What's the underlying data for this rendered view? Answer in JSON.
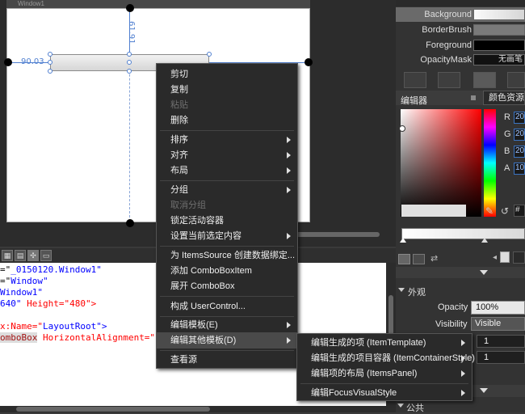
{
  "window": {
    "title": "Window1"
  },
  "design": {
    "height_label": "61.91",
    "left_label": "90.03"
  },
  "xaml_lines": [
    {
      "pre": "=\"",
      "val": "_0150120.Window1\"",
      "post": ""
    },
    {
      "pre": "=\"",
      "val": "Window\"",
      "post": ""
    },
    {
      "pre": "",
      "val": "Window1\"",
      "post": ""
    },
    {
      "pre": "",
      "val": "640\"",
      "post": " Height=\"480\">"
    },
    {
      "pre": "",
      "val": "",
      "post": ""
    },
    {
      "pre": "x:Name=\"",
      "val": "LayoutRoot\">",
      "post": ""
    },
    {
      "pre": "omboBox",
      "val": "",
      "post": " HorizontalAlignment=\"Lef"
    }
  ],
  "properties": {
    "brushes": [
      {
        "label": "Background",
        "color": "#e8e8e8"
      },
      {
        "label": "BorderBrush",
        "color": "#808080"
      },
      {
        "label": "Foreground",
        "color": "#000000"
      },
      {
        "label": "OpacityMask",
        "value": "无画笔"
      }
    ],
    "editor_label": "编辑器",
    "color_resources": "颜色资源",
    "rgba": [
      {
        "k": "R",
        "v": "20"
      },
      {
        "k": "G",
        "v": "20"
      },
      {
        "k": "B",
        "v": "20"
      },
      {
        "k": "A",
        "v": "10"
      }
    ],
    "hex_prefix": "#",
    "appearance_header": "外观",
    "opacity_label": "Opacity",
    "opacity_value": "100%",
    "visibility_label": "Visibility",
    "visibility_value": "Visible",
    "stepper1": "1",
    "stepper2": "1",
    "public_header": "公共"
  },
  "context_menu": {
    "items": [
      {
        "label": "剪切",
        "enabled": true,
        "submenu": false
      },
      {
        "label": "复制",
        "enabled": true,
        "submenu": false
      },
      {
        "label": "粘贴",
        "enabled": false,
        "submenu": false
      },
      {
        "label": "删除",
        "enabled": true,
        "submenu": false
      },
      {
        "label": "排序",
        "enabled": true,
        "submenu": true
      },
      {
        "label": "对齐",
        "enabled": true,
        "submenu": true
      },
      {
        "label": "布局",
        "enabled": true,
        "submenu": true
      },
      {
        "label": "分组",
        "enabled": true,
        "submenu": true
      },
      {
        "label": "取消分组",
        "enabled": false,
        "submenu": false
      },
      {
        "label": "锁定活动容器",
        "enabled": true,
        "submenu": false
      },
      {
        "label": "设置当前选定内容",
        "enabled": true,
        "submenu": true
      },
      {
        "label": "为 ItemsSource 创建数据绑定...",
        "enabled": true,
        "submenu": false
      },
      {
        "label": "添加 ComboBoxItem",
        "enabled": true,
        "submenu": false
      },
      {
        "label": "展开 ComboBox",
        "enabled": true,
        "submenu": false
      },
      {
        "label": "构成 UserControl...",
        "enabled": true,
        "submenu": false
      },
      {
        "label": "编辑模板(E)",
        "enabled": true,
        "submenu": true
      },
      {
        "label": "编辑其他模板(D)",
        "enabled": true,
        "submenu": true
      },
      {
        "label": "查看源",
        "enabled": true,
        "submenu": false
      }
    ]
  },
  "submenu": {
    "items": [
      {
        "label": "编辑生成的项 (ItemTemplate)"
      },
      {
        "label": "编辑生成的项目容器 (ItemContainerStyle)"
      },
      {
        "label": "编辑项的布局 (ItemsPanel)"
      },
      {
        "label": "编辑FocusVisualStyle"
      }
    ]
  }
}
